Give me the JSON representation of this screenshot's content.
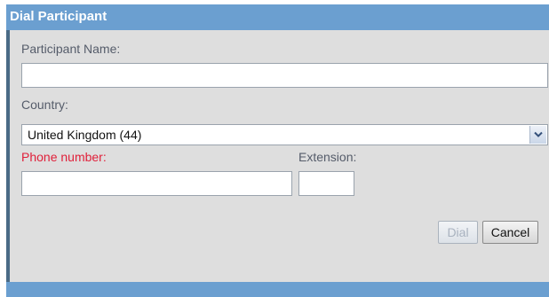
{
  "dialog": {
    "title": "Dial Participant"
  },
  "form": {
    "participant_name_label": "Participant Name:",
    "participant_name_value": "",
    "country_label": "Country:",
    "country_selected": "United Kingdom (44)",
    "phone_label": "Phone number:",
    "phone_value": "",
    "extension_label": "Extension:",
    "extension_value": ""
  },
  "buttons": {
    "dial_label": "Dial",
    "cancel_label": "Cancel"
  },
  "colors": {
    "titlebar": "#6b9fd0",
    "required_label": "#e0203a",
    "dialog_background": "#dedede"
  },
  "icons": {
    "select_arrow": "chevron-down-icon"
  }
}
